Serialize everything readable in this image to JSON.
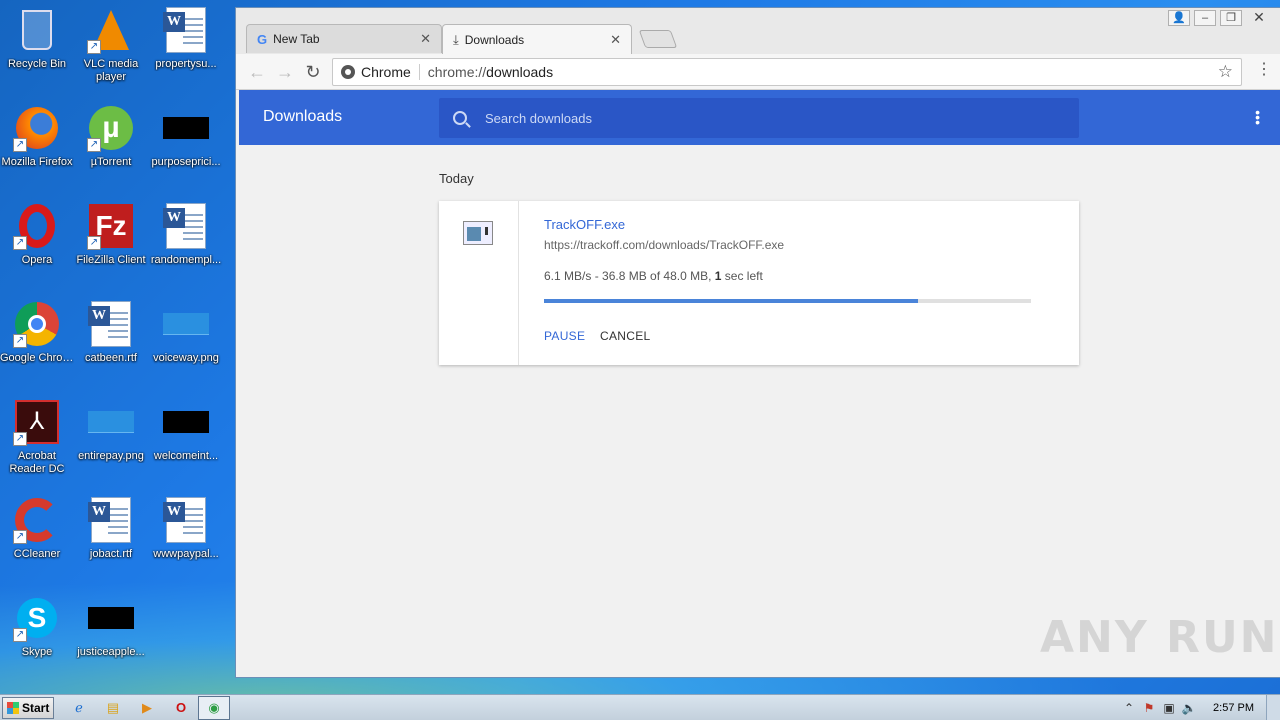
{
  "desktop": {
    "icons": [
      {
        "label": "Recycle Bin",
        "icon": "recycle-bin-icon"
      },
      {
        "label": "VLC media player",
        "icon": "vlc-icon"
      },
      {
        "label": "propertysu...",
        "icon": "word-doc-icon"
      },
      {
        "label": "Mozilla Firefox",
        "icon": "firefox-icon"
      },
      {
        "label": "µTorrent",
        "icon": "utorrent-icon"
      },
      {
        "label": "purposeprici...",
        "icon": "image-thumb-icon"
      },
      {
        "label": "Opera",
        "icon": "opera-icon"
      },
      {
        "label": "FileZilla Client",
        "icon": "filezilla-icon"
      },
      {
        "label": "randomempl...",
        "icon": "word-doc-icon"
      },
      {
        "label": "Google Chrome",
        "icon": "chrome-icon"
      },
      {
        "label": "catbeen.rtf",
        "icon": "word-doc-icon"
      },
      {
        "label": "voiceway.png",
        "icon": "image-thumb-icon"
      },
      {
        "label": "Acrobat Reader DC",
        "icon": "acrobat-icon"
      },
      {
        "label": "entirepay.png",
        "icon": "image-thumb-icon"
      },
      {
        "label": "welcomeint...",
        "icon": "image-thumb-icon"
      },
      {
        "label": "CCleaner",
        "icon": "ccleaner-icon"
      },
      {
        "label": "jobact.rtf",
        "icon": "word-doc-icon"
      },
      {
        "label": "wwwpaypal...",
        "icon": "word-doc-icon"
      },
      {
        "label": "Skype",
        "icon": "skype-icon"
      },
      {
        "label": "justiceapple...",
        "icon": "image-thumb-icon"
      }
    ]
  },
  "browser": {
    "tabs": [
      {
        "title": "New Tab",
        "icon": "google-g-icon"
      },
      {
        "title": "Downloads",
        "icon": "download-icon"
      }
    ],
    "omnibox": {
      "scheme_label": "Chrome",
      "url_prefix": "chrome://",
      "url_host": "downloads"
    }
  },
  "downloads_page": {
    "title": "Downloads",
    "search_placeholder": "Search downloads",
    "section_label": "Today",
    "items": [
      {
        "file_name": "TrackOFF.exe",
        "url": "https://trackoff.com/downloads/TrackOFF.exe",
        "speed": "6.1 MB/s",
        "separator": " - ",
        "progress_text": "36.8 MB of 48.0 MB, ",
        "time_value": "1",
        "time_suffix": " sec left",
        "progress_fraction": 0.767,
        "pause_label": "PAUSE",
        "cancel_label": "CANCEL"
      }
    ]
  },
  "watermark": "ANY RUN",
  "taskbar": {
    "start_label": "Start",
    "clock": "2:57 PM"
  },
  "colors": {
    "header_blue": "#3367d6",
    "search_blue": "#2a56c6",
    "progress_blue": "#4a84d9"
  }
}
